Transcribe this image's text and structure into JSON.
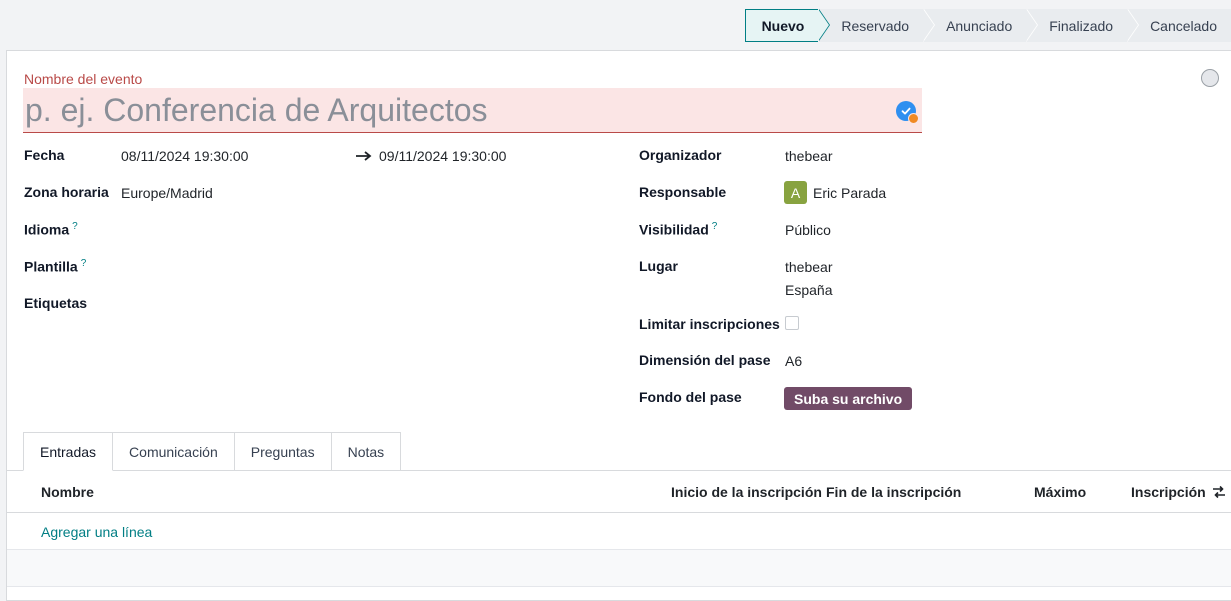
{
  "statusbar": {
    "stages": [
      "Nuevo",
      "Reservado",
      "Anunciado",
      "Finalizado",
      "Cancelado"
    ],
    "active": "Nuevo"
  },
  "form": {
    "name_label": "Nombre del evento",
    "name_placeholder": "p. ej. Conferencia de Arquitectos",
    "left": {
      "fecha_label": "Fecha",
      "fecha_start": "08/11/2024 19:30:00",
      "fecha_end": "09/11/2024 19:30:00",
      "zona_label": "Zona horaria",
      "zona_value": "Europe/Madrid",
      "idioma_label": "Idioma",
      "plantilla_label": "Plantilla",
      "etiquetas_label": "Etiquetas",
      "help_mark": "?"
    },
    "right": {
      "organizador_label": "Organizador",
      "organizador_value": "thebear",
      "responsable_label": "Responsable",
      "responsable_initial": "A",
      "responsable_value": "Eric Parada",
      "visibilidad_label": "Visibilidad",
      "visibilidad_value": "Público",
      "lugar_label": "Lugar",
      "lugar_line1": "thebear",
      "lugar_line2": "España",
      "limitar_label": "Limitar inscripciones",
      "dimension_label": "Dimensión del pase",
      "dimension_value": "A6",
      "fondo_label": "Fondo del pase",
      "upload_label": "Suba su archivo"
    }
  },
  "tabs": [
    "Entradas",
    "Comunicación",
    "Preguntas",
    "Notas"
  ],
  "table": {
    "columns": [
      "Nombre",
      "Inicio de la inscripción",
      "Fin de la inscripción",
      "Máximo",
      "Inscripción"
    ],
    "add_line": "Agregar una línea"
  },
  "colors": {
    "accent": "#017e84",
    "brand": "#714b67",
    "invalid": "#b94a48",
    "avatar": "#88a340"
  }
}
